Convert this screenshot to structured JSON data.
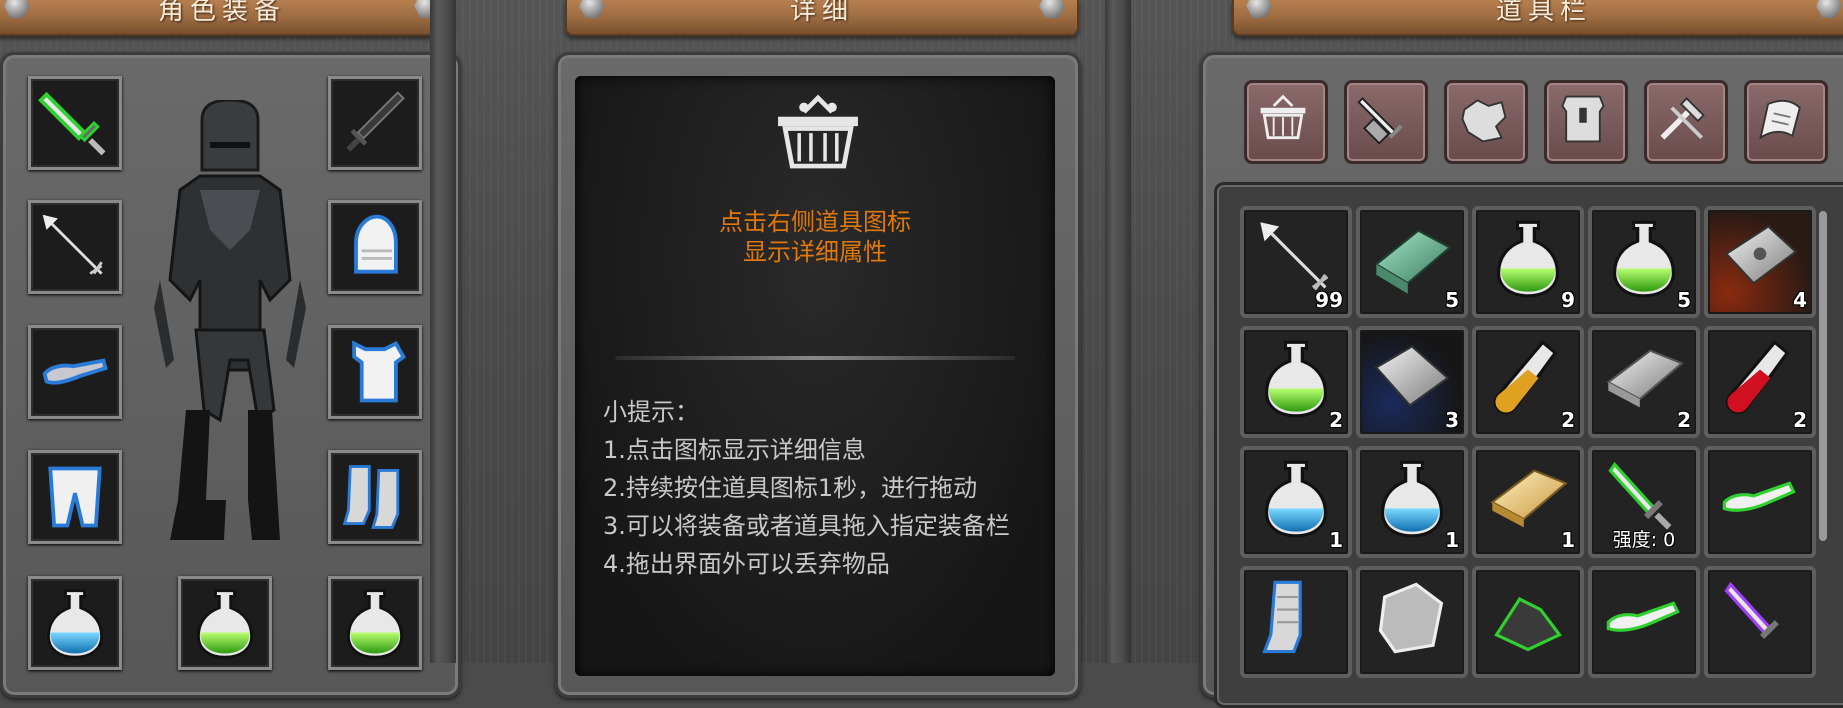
{
  "equipment_panel": {
    "title": "角色装备",
    "left_slots": [
      "sword-icon",
      "arrow-icon",
      "glove-icon",
      "pants-icon",
      "blue-potion-icon"
    ],
    "right_slots": [
      "dark-sword-icon",
      "helmet-icon",
      "chestplate-icon",
      "boots-icon",
      "green-potion-icon"
    ],
    "bottom_middle": "green-potion-icon"
  },
  "detail_panel": {
    "title": "详细",
    "prompt_line1": "点击右侧道具图标",
    "prompt_line2": "显示详细属性",
    "tips_title": "小提示：",
    "tips": [
      "1.点击图标显示详细信息",
      "2.持续按住道具图标1秒，进行拖动",
      "3.可以将装备或者道具拖入指定装备栏",
      "4.拖出界面外可以丢弃物品"
    ]
  },
  "inventory_panel": {
    "title": "道具栏",
    "tabs": [
      "basket-icon",
      "weapon-icon",
      "ore-icon",
      "armor-icon",
      "crafting-icon",
      "scroll-icon"
    ],
    "rows": [
      [
        {
          "icon": "arrow-icon",
          "count": "99"
        },
        {
          "icon": "jade-bar-icon",
          "count": "5"
        },
        {
          "icon": "green-potion-icon",
          "count": "9"
        },
        {
          "icon": "green-potion-icon",
          "count": "5"
        },
        {
          "icon": "iron-plate-icon",
          "count": "4"
        }
      ],
      [
        {
          "icon": "green-potion-icon",
          "count": "2"
        },
        {
          "icon": "steel-bar-icon",
          "count": "3"
        },
        {
          "icon": "orange-vial-icon",
          "count": "2"
        },
        {
          "icon": "silver-bar-icon",
          "count": "2"
        },
        {
          "icon": "red-vial-icon",
          "count": "2"
        }
      ],
      [
        {
          "icon": "blue-potion-icon",
          "count": "1"
        },
        {
          "icon": "blue-potion-icon",
          "count": "1"
        },
        {
          "icon": "gold-bar-icon",
          "count": "1"
        },
        {
          "icon": "green-sword-icon",
          "strength": "强度: 0"
        },
        {
          "icon": "gauntlet-icon"
        }
      ],
      [
        {
          "icon": "boots-icon"
        },
        {
          "icon": "stone-icon"
        },
        {
          "icon": "dark-ore-icon"
        },
        {
          "icon": "gauntlet-icon"
        },
        {
          "icon": "purple-sword-icon"
        }
      ]
    ],
    "row_labels": {
      "row4_partial": "强度: 0"
    }
  }
}
